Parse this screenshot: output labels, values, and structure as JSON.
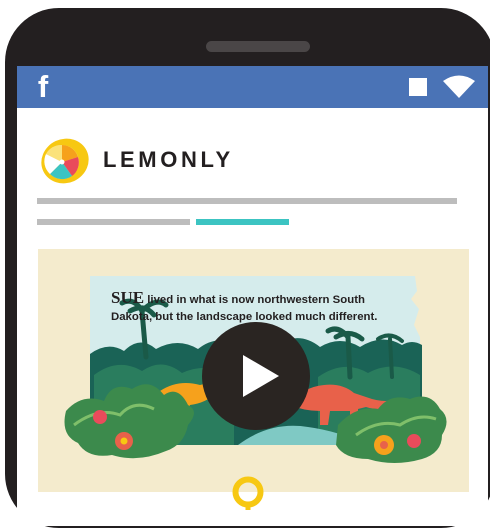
{
  "header": {
    "app_icon": "facebook-f-icon",
    "status_icons": [
      "stop-square-icon",
      "wifi-icon"
    ],
    "accent": "#4a73b6"
  },
  "brand": {
    "logo_icon": "lemon-slice-logo",
    "name": "LEMONLY"
  },
  "progress": {
    "segments": [
      {
        "color": "#bdbdbd"
      },
      {
        "color": "#bdbdbd"
      },
      {
        "color": "#3cc4c2"
      }
    ]
  },
  "video": {
    "caption_lead": "SUE",
    "caption_line1": " lived in what is now northwestern South",
    "caption_line2": "Dakota, but the landscape looked much different.",
    "play_icon": "play-icon",
    "background": "#f4ebcd"
  },
  "indicator": {
    "icon": "location-ring-icon",
    "color": "#f7c812"
  }
}
